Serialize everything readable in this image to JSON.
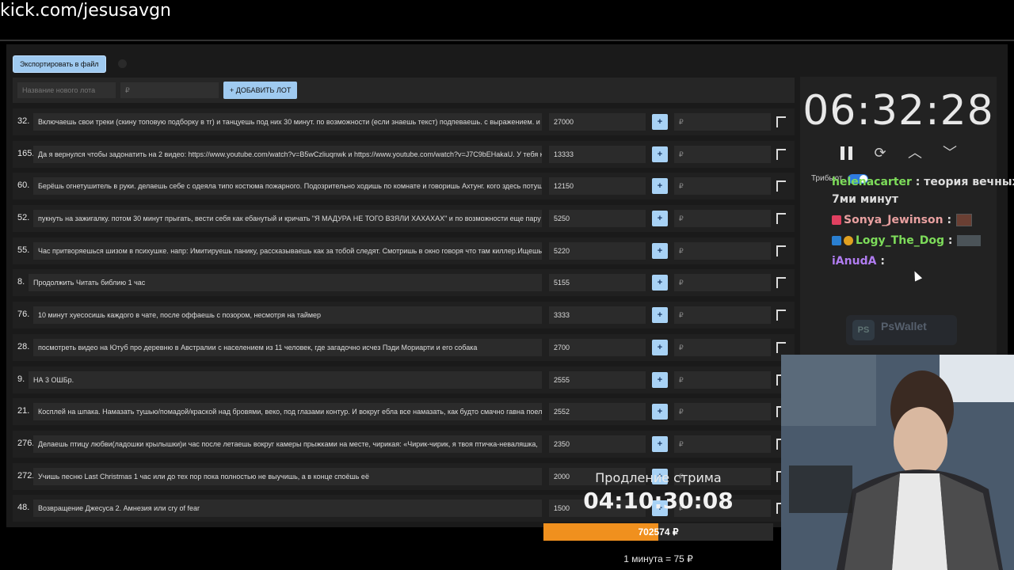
{
  "url": "kick.com/jesusavgn",
  "export_label": "Экспортировать в файл",
  "new_lot": {
    "name_placeholder": "Название нового лота",
    "price_placeholder": "₽",
    "add_label": "+ ДОБАВИТЬ ЛОТ"
  },
  "plus_label": "+",
  "rub_placeholder": "₽",
  "lots": [
    {
      "num": "32.",
      "text": "Включаешь свои треки (скину топовую подборку в тг) и танцуешь под них 30 минут. по возможности (если знаешь текст) подпеваешь. с выражением. и и",
      "amount": "27000"
    },
    {
      "num": "165.",
      "text": "Да я вернулся чтобы задонатить на 2 видео: https://www.youtube.com/watch?v=B5wCzliuqnwk и https://www.youtube.com/watch?v=J7C9bEHakaU. У тебя к",
      "amount": "13333"
    },
    {
      "num": "60.",
      "text": "Берёшь огнетушитель в руки. делаешь себе с одеяла типо костюма пожарного. Подозрительно ходишь по комнате и говоришь Ахтунг. кого здесь потуш",
      "amount": "12150"
    },
    {
      "num": "52.",
      "text": "пукнуть на зажигалку. потом 30 минут прыгать, вести себя как ебанутый и кричать \"Я МАДУРА НЕ ТОГО ВЗЯЛИ ХАХАХАХ\" и по возможности еще пару р",
      "amount": "5250"
    },
    {
      "num": "55.",
      "text": "Час притворяешься шизом в психушке. напр: Имитируешь панику, рассказываешь как за тобой следят. Смотришь в окно говоря что там киллер.Ищешь с",
      "amount": "5220"
    },
    {
      "num": "8.",
      "text": "Продолжить Читать библию 1 час",
      "amount": "5155"
    },
    {
      "num": "76.",
      "text": "10 минут хуесосишь каждого в чате, после оффаешь с позором, несмотря на таймер",
      "amount": "3333"
    },
    {
      "num": "28.",
      "text": "посмотреть видео на Ютуб про деревню в Австралии с населением из 11 человек, где загадочно исчез Пэди Мориарти и его собака",
      "amount": "2700"
    },
    {
      "num": "9.",
      "text": "НА 3 ОШБр.",
      "amount": "2555"
    },
    {
      "num": "21.",
      "text": "Косплей на шпака. Намазать тушью/помадой/краской над бровями, веко, под глазами контур. И вокруг ебла все намазать, как будто смачно гавна поел.",
      "amount": "2552"
    },
    {
      "num": "276.",
      "text": "Делаешь птицу любви(ладошки крылышки)и час после летаешь вокруг камеры прыжками на месте, чирикая: «Чирик-чирик, я твоя птичка-неваляшка, ",
      "amount": "2350"
    },
    {
      "num": "272.",
      "text": "Учишь песню Last Christmas 1 час или до тех пор пока полностью не выучишь, а в конце споёшь её",
      "amount": "2000"
    },
    {
      "num": "48.",
      "text": "Возвращение Джесуса 2. Амнезия или cry of fear",
      "amount": "1500"
    }
  ],
  "timer": {
    "time": "06:32:28",
    "tribute_label": "Трибьют"
  },
  "chat": [
    {
      "user": "helenacarter",
      "message": "теория вечных",
      "color": "#7ddc5a"
    },
    {
      "user": "",
      "message": "7ми минут",
      "color": "#ddd"
    },
    {
      "user": "Sonya_Jewinson",
      "message": ":",
      "color": "#e8a0a0"
    },
    {
      "user": "Logy_The_Dog",
      "message": ":",
      "color": "#7ddc5a"
    },
    {
      "user": "iAnudA",
      "message": ":",
      "color": "#b07cf0"
    }
  ],
  "wallet_label": "PsWallet",
  "wallet_logo": "PS",
  "extension": {
    "title": "Продление стрима",
    "time": "04:10:30:08",
    "total": "702574 ₽",
    "rate": "1 минута = 75 ₽",
    "progress": 0.5
  },
  "colors": {
    "accent": "#9fcaf0",
    "progress": "#f0901e"
  }
}
